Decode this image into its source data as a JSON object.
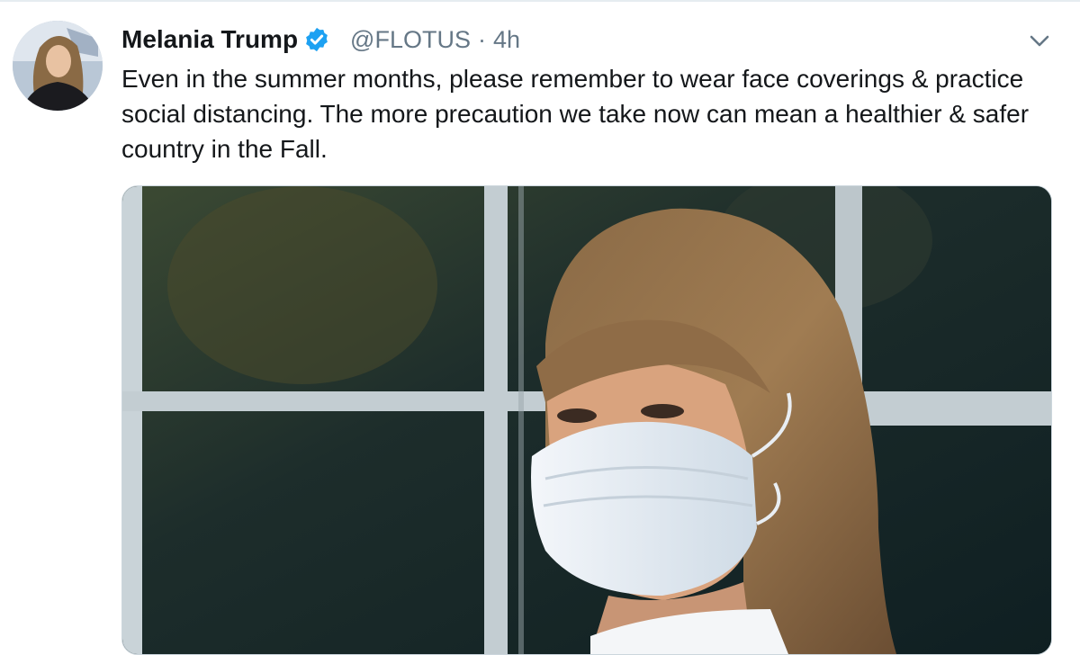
{
  "tweet": {
    "author_name": "Melania Trump",
    "handle": "@FLOTUS",
    "separator": "·",
    "timestamp": "4h",
    "verified": true,
    "text": "Even in the summer months, please remember to wear face coverings & practice social distancing. The more precaution we take now can mean a healthier & safer country in the Fall."
  },
  "icons": {
    "verified": "verified-badge-icon",
    "menu": "chevron-down-icon"
  },
  "colors": {
    "verified_blue": "#1da1f2",
    "secondary_text": "#657786",
    "primary_text": "#14171a"
  }
}
